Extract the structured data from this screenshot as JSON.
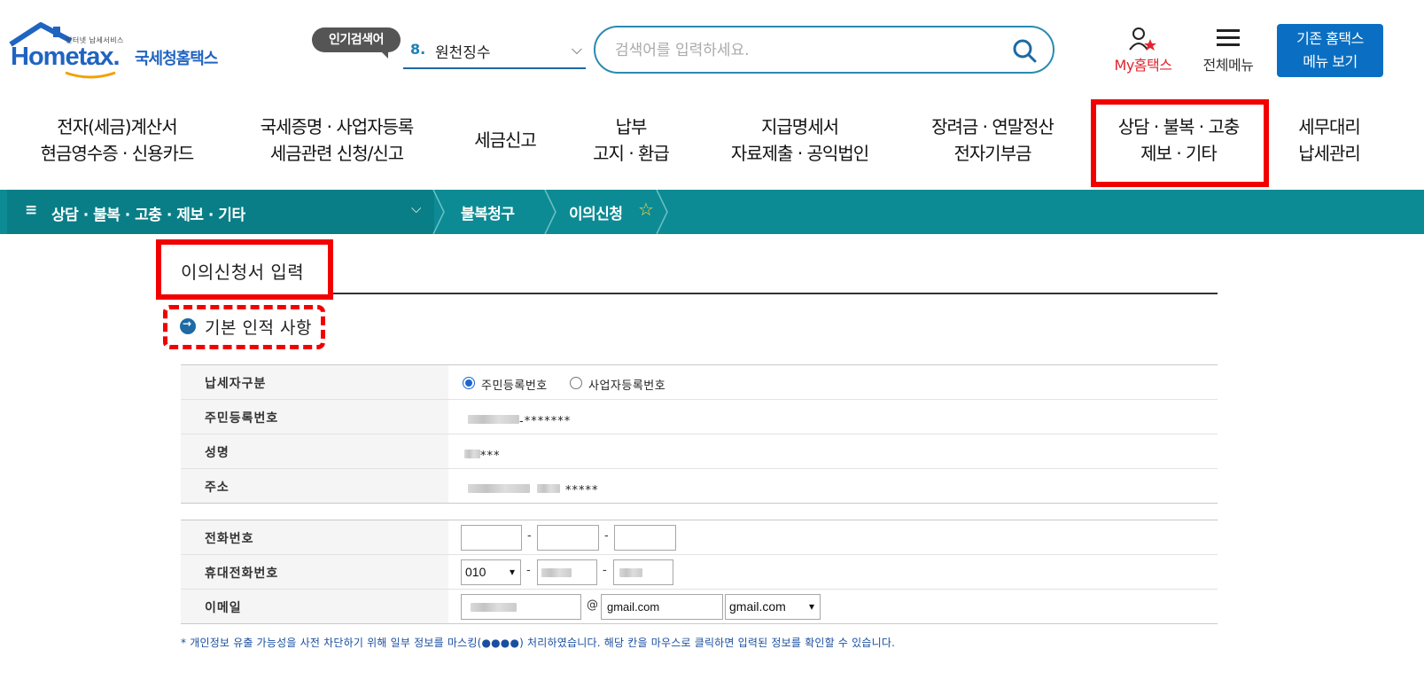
{
  "header": {
    "logo_small": "인터넷 납세서비스",
    "logo_word": "Hometax.",
    "logo_kr": "국세청홈택스",
    "popular_badge": "인기검색어",
    "popular_rank": "8.",
    "popular_term": "원천징수",
    "search_placeholder": "검색어를 입력하세요.",
    "my_hometax": "My홈택스",
    "all_menu": "전체메뉴",
    "legacy_line1": "기존 홈택스",
    "legacy_line2": "메뉴 보기"
  },
  "gnb": [
    {
      "line1": "전자(세금)계산서",
      "line2": "현금영수증 · 신용카드"
    },
    {
      "line1": "국세증명 · 사업자등록",
      "line2": "세금관련 신청/신고"
    },
    {
      "line1": "세금신고",
      "line2": ""
    },
    {
      "line1": "납부",
      "line2": "고지 · 환급"
    },
    {
      "line1": "지급명세서",
      "line2": "자료제출 · 공익법인"
    },
    {
      "line1": "장려금 · 연말정산",
      "line2": "전자기부금"
    },
    {
      "line1": "상담 · 불복 · 고충",
      "line2": "제보 · 기타"
    },
    {
      "line1": "세무대리",
      "line2": "납세관리"
    }
  ],
  "breadcrumb": {
    "menu_icon": "≡",
    "menu_label": "상담 · 불복 · 고충 · 제보 · 기타",
    "level2": "불복청구",
    "level3": "이의신청"
  },
  "main": {
    "page_title": "이의신청서 입력",
    "section_title": "기본 인적 사항",
    "rows": {
      "taxpayer_type_label": "납세자구분",
      "radio_resident": "주민등록번호",
      "radio_business": "사업자등록번호",
      "resident_no_label": "주민등록번호",
      "resident_no_mask": "-*******",
      "name_label": "성명",
      "name_mask": "***",
      "address_label": "주소",
      "address_mask": "*****",
      "phone_label": "전화번호",
      "mobile_label": "휴대전화번호",
      "mobile_prefix": "010",
      "email_label": "이메일",
      "email_at": "@",
      "email_domain_input": "gmail.com",
      "email_domain_select": "gmail.com",
      "dash": "-"
    },
    "note": "* 개인정보 유출 가능성을 사전 차단하기 위해 일부 정보를 마스킹(●●●●) 처리하였습니다. 해당 칸을 마우스로 클릭하면 입력된 정보를 확인할 수 있습니다."
  },
  "colors": {
    "brand_blue": "#1f64c1",
    "teal_bar": "#0c8b94",
    "highlight_red": "#f20000",
    "my_red": "#e0242f"
  }
}
